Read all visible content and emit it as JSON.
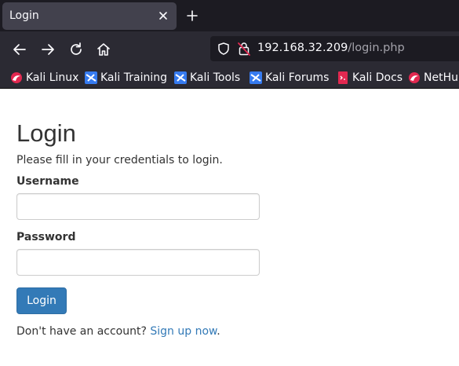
{
  "browser": {
    "tab": {
      "title": "Login",
      "close_icon": "close-icon"
    },
    "new_tab_icon": "plus-icon",
    "nav": {
      "back_icon": "arrow-left-icon",
      "forward_icon": "arrow-right-icon",
      "reload_icon": "reload-icon",
      "home_icon": "home-icon"
    },
    "url": {
      "host": "192.168.32.209",
      "path": "/login.php",
      "shield_icon": "shield-icon",
      "lock_icon": "insecure-lock-icon"
    },
    "bookmarks": [
      {
        "label": "Kali Linux",
        "icon": "kali-dragon-icon"
      },
      {
        "label": "Kali Training",
        "icon": "kali-training-icon"
      },
      {
        "label": "Kali Tools",
        "icon": "kali-tools-icon"
      },
      {
        "label": "Kali Forums",
        "icon": "kali-forums-icon"
      },
      {
        "label": "Kali Docs",
        "icon": "kali-docs-icon"
      },
      {
        "label": "NetHunter",
        "icon": "kali-dragon-icon"
      }
    ]
  },
  "page": {
    "title": "Login",
    "subtitle": "Please fill in your credentials to login.",
    "username_label": "Username",
    "username_value": "",
    "password_label": "Password",
    "password_value": "",
    "login_button": "Login",
    "signup_prompt": "Don't have an account?",
    "signup_link": "Sign up now",
    "signup_suffix": "."
  },
  "colors": {
    "tabbar_bg": "#1c1b22",
    "toolbar_bg": "#2b2a33",
    "primary_button": "#337ab7",
    "link": "#337ab7"
  }
}
